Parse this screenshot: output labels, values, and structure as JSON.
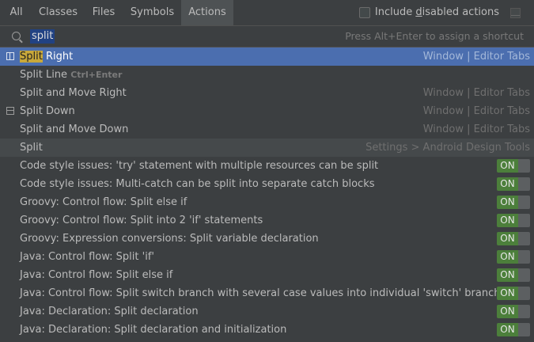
{
  "tabs": [
    {
      "label": "All",
      "active": false
    },
    {
      "label": "Classes",
      "active": false
    },
    {
      "label": "Files",
      "active": false
    },
    {
      "label": "Symbols",
      "active": false
    },
    {
      "label": "Actions",
      "active": true
    }
  ],
  "include_disabled": {
    "label_before": "Include ",
    "label_underline": "d",
    "label_after": "isabled actions",
    "checked": false
  },
  "search": {
    "value": "split",
    "hint": "Press Alt+Enter to assign a shortcut"
  },
  "results": [
    {
      "highlight": "Split",
      "rest": " Right",
      "shortcut": "",
      "location": "Window | Editor Tabs",
      "icon": "split-right-icon",
      "selected": true
    },
    {
      "highlight": "",
      "rest": "Split Line",
      "shortcut": "Ctrl+Enter",
      "location": "",
      "icon": "",
      "selected": false
    },
    {
      "highlight": "",
      "rest": "Split and Move Right",
      "shortcut": "",
      "location": "Window | Editor Tabs",
      "icon": "",
      "selected": false
    },
    {
      "highlight": "",
      "rest": "Split Down",
      "shortcut": "",
      "location": "Window | Editor Tabs",
      "icon": "split-down-icon",
      "selected": false
    },
    {
      "highlight": "",
      "rest": "Split and Move Down",
      "shortcut": "",
      "location": "Window | Editor Tabs",
      "icon": "",
      "selected": false
    },
    {
      "highlight": "",
      "rest": "Split",
      "shortcut": "",
      "location": "Settings > Android Design Tools",
      "icon": "",
      "selected": false,
      "alt": true
    },
    {
      "highlight": "",
      "rest": "Code style issues: 'try' statement with multiple resources can be split",
      "toggle": "ON"
    },
    {
      "highlight": "",
      "rest": "Code style issues: Multi-catch can be split into separate catch blocks",
      "toggle": "ON"
    },
    {
      "highlight": "",
      "rest": "Groovy: Control flow: Split else if",
      "toggle": "ON"
    },
    {
      "highlight": "",
      "rest": "Groovy: Control flow: Split into 2 'if' statements",
      "toggle": "ON"
    },
    {
      "highlight": "",
      "rest": "Groovy: Expression conversions: Split variable declaration",
      "toggle": "ON"
    },
    {
      "highlight": "",
      "rest": "Java: Control flow: Split 'if'",
      "toggle": "ON"
    },
    {
      "highlight": "",
      "rest": "Java: Control flow: Split else if",
      "toggle": "ON"
    },
    {
      "highlight": "",
      "rest": "Java: Control flow: Split switch branch with several case values into individual 'switch' branches",
      "toggle": "ON"
    },
    {
      "highlight": "",
      "rest": "Java: Declaration: Split declaration",
      "toggle": "ON"
    },
    {
      "highlight": "",
      "rest": "Java: Declaration: Split declaration and initialization",
      "toggle": "ON"
    }
  ],
  "colors": {
    "background": "#3c3f41",
    "selection": "#4b6eaf",
    "highlight": "#c8a83a",
    "toggle_on": "#4c7f3b"
  }
}
